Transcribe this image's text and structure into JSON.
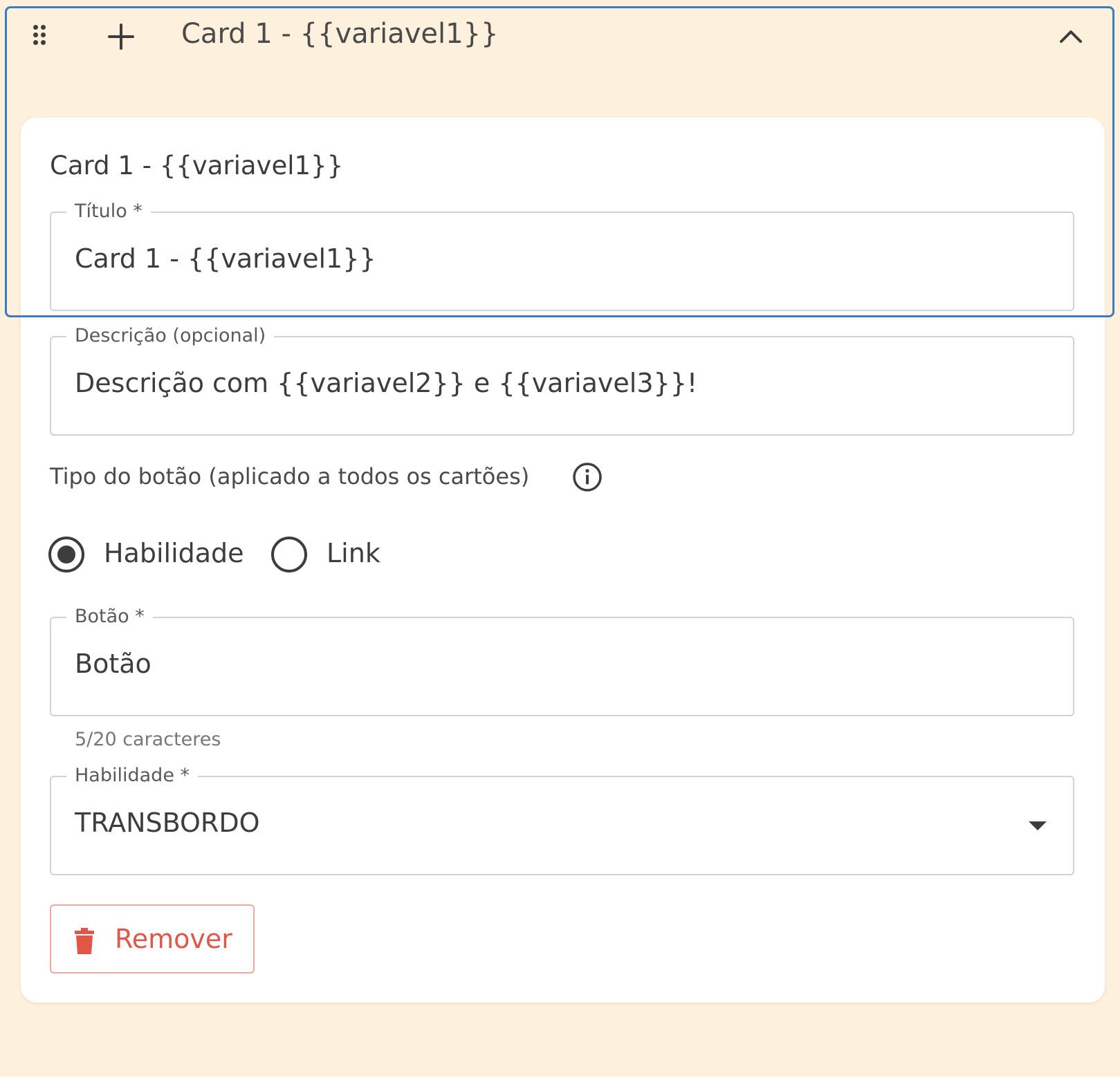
{
  "header": {
    "title": "Card 1 - {{variavel1}}",
    "drag_icon": "drag-handle-icon",
    "add_icon": "plus-icon",
    "collapse_icon": "chevron-up-icon"
  },
  "card": {
    "title": "Card 1 - {{variavel1}}",
    "title_field": {
      "label": "Título *",
      "value": "Card 1 - {{variavel1}}"
    },
    "description_field": {
      "label": "Descrição (opcional)",
      "value": "Descrição com {{variavel2}} e  {{variavel3}}!"
    },
    "button_type": {
      "label": "Tipo do botão (aplicado a todos os cartões)",
      "info_icon": "info-icon",
      "options": [
        {
          "label": "Habilidade",
          "checked": true
        },
        {
          "label": "Link",
          "checked": false
        }
      ]
    },
    "button_field": {
      "label": "Botão *",
      "value": "Botão",
      "hint": "5/20 caracteres"
    },
    "skill_field": {
      "label": "Habilidade *",
      "value": "TRANSBORDO"
    },
    "remove_button": {
      "label": "Remover",
      "icon": "trash-icon"
    }
  },
  "colors": {
    "panel_background": "#fdf0dc",
    "focus_outline": "#3b7bbf",
    "danger": "#e0574a",
    "danger_border": "#f0a99f"
  }
}
